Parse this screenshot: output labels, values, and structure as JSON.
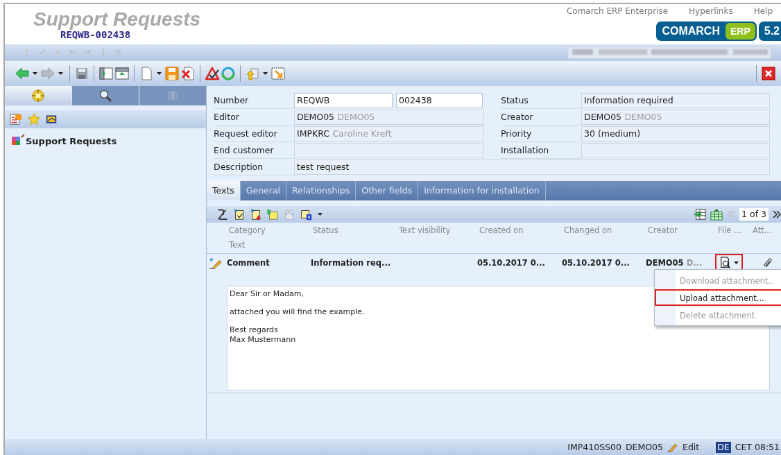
{
  "header": {
    "title": "Support Requests",
    "record_number": "REQWB-002438",
    "links": [
      "Comarch ERP Enterprise",
      "Hyperlinks",
      "Help"
    ],
    "logo": {
      "brand": "COMARCH",
      "product": "ERP",
      "version": "5.2"
    }
  },
  "sidebar": {
    "tabs": [
      {
        "selected": true
      },
      {
        "selected": false
      },
      {
        "selected": false
      }
    ],
    "tree": [
      {
        "label": "Support Requests"
      }
    ]
  },
  "form": {
    "rows": [
      [
        {
          "label": "Number",
          "value": "REQWB",
          "value_2": "002438",
          "editable": true
        },
        {
          "label": "Status",
          "value": "Information required",
          "editable": false
        }
      ],
      [
        {
          "label": "Editor",
          "value": "DEMO05",
          "detail": "DEMO05",
          "editable": false
        },
        {
          "label": "Creator",
          "value": "DEMO05",
          "detail": "DEMO05",
          "editable": false
        }
      ],
      [
        {
          "label": "Request editor",
          "value": "IMPKRC",
          "detail": "Caroline Kreft",
          "editable": false
        },
        {
          "label": "Priority",
          "value": "30 (medium)",
          "editable": false
        }
      ],
      [
        {
          "label": "End customer",
          "editable": false
        },
        {
          "label": "Installation",
          "editable": false
        }
      ],
      [
        {
          "label": "Description",
          "value": "test request",
          "editable": false
        }
      ]
    ]
  },
  "tabs": [
    {
      "label": "Texts",
      "selected": true
    },
    {
      "label": "General",
      "selected": false
    },
    {
      "label": "Relationships",
      "selected": false
    },
    {
      "label": "Other fields",
      "selected": false
    },
    {
      "label": "Information for installation",
      "selected": false
    }
  ],
  "texts_table": {
    "pager": "1 of 3",
    "columns": [
      "Category",
      "Status",
      "Text visibility",
      "Created on",
      "Changed on",
      "Creator",
      "File ...",
      "Att..."
    ],
    "second_header": "Text",
    "rows": [
      {
        "category": "Comment",
        "status": "Information req...",
        "created_on": "05.10.2017 0...",
        "changed_on": "05.10.2017 0...",
        "creator": "DEMO05",
        "creator_name": "D...",
        "file_button_highlighted": true,
        "body": [
          [
            "Dear Sir or Madam,"
          ],
          [
            "attached you will find the example."
          ],
          [
            "Best regards",
            "Max Mustermann"
          ]
        ]
      }
    ]
  },
  "file_menu": {
    "items": [
      {
        "label": "Download attachment..",
        "disabled": true,
        "highlighted": false
      },
      {
        "label": "Upload attachment...",
        "disabled": false,
        "highlighted": true
      },
      {
        "label": "Delete attachment",
        "disabled": true,
        "highlighted": false
      }
    ]
  },
  "status_bar": {
    "system": "IMP410SS00",
    "user": "DEMO05",
    "mode": "Edit",
    "language": "DE",
    "time": "CET 08:51"
  }
}
